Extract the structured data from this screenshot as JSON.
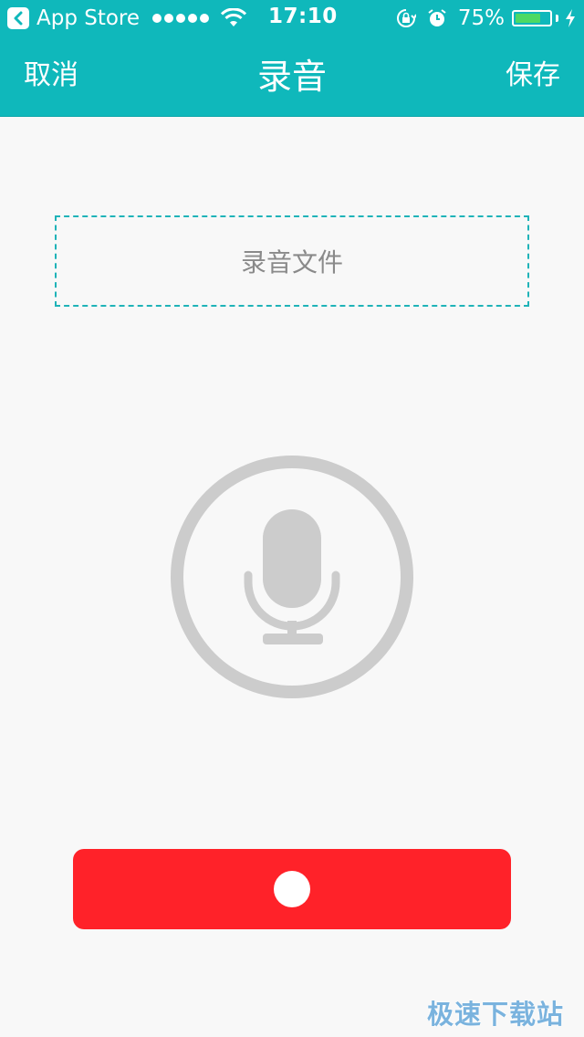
{
  "status_bar": {
    "back_app": "App Store",
    "time": "17:10",
    "battery_percent": "75%",
    "battery_level": 0.75,
    "signal_bars": 5,
    "icons": [
      "back-icon",
      "wifi-icon",
      "rotation-lock-icon",
      "alarm-icon",
      "battery-icon",
      "charging-bolt-icon"
    ]
  },
  "nav": {
    "cancel": "取消",
    "title": "录音",
    "save": "保存"
  },
  "file_box": {
    "label": "录音文件"
  },
  "mic": {
    "icon": "microphone-icon"
  },
  "record": {
    "icon": "record-dot-icon"
  },
  "watermark": "极速下载站",
  "colors": {
    "header": "#0fb8bb",
    "record_button": "#ff2229",
    "battery_fill": "#4cd964",
    "dashed_border": "#1fb3b8",
    "mic_gray": "#cccccc"
  }
}
